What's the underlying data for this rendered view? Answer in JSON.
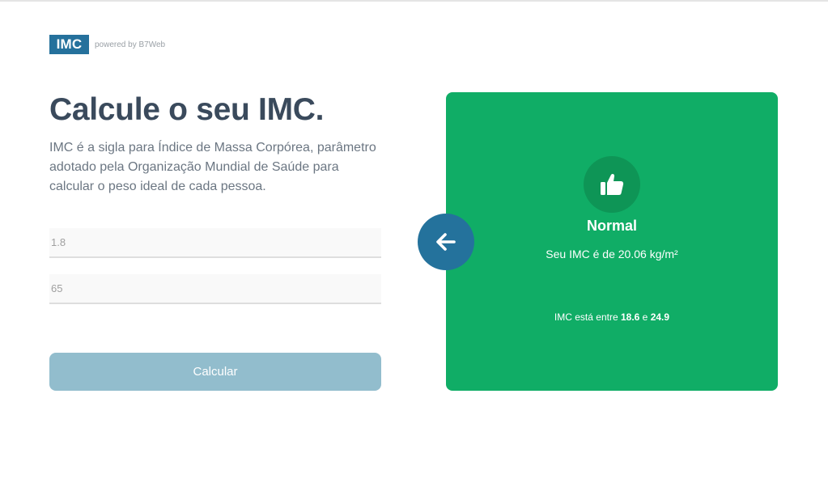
{
  "header": {
    "logo_text": "IMC",
    "powered_by": "powered by B7Web"
  },
  "intro": {
    "title": "Calcule o seu IMC.",
    "description": "IMC é a sigla para Índice de Massa Corpórea, parâmetro adotado pela Organização Mundial de Saúde para calcular o peso ideal de cada pessoa."
  },
  "form": {
    "height_value": "1.8",
    "weight_value": "65",
    "calculate_label": "Calcular"
  },
  "result": {
    "icon": "thumbs-up-icon",
    "title": "Normal",
    "value_text": "Seu IMC é de 20.06 kg/m²",
    "range_prefix": "IMC está entre",
    "range_min": "18.6",
    "range_joiner": "e",
    "range_max": "24.9"
  },
  "colors": {
    "brand": "#25719c",
    "result_normal": "#10ad66",
    "button_disabled": "#92bdcd",
    "title_text": "#3a4a5c"
  }
}
